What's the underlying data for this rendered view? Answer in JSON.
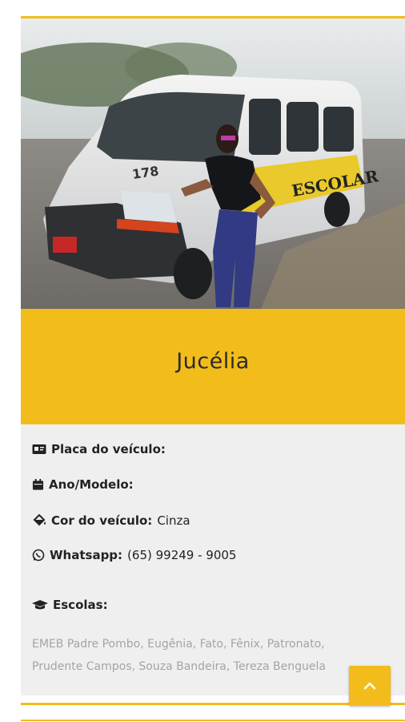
{
  "colors": {
    "accent": "#f2bc1b",
    "panel": "#efefef",
    "muted_text": "#a4a4a4"
  },
  "driver": {
    "name": "Jucélia"
  },
  "vehicle_photo": {
    "number": "178",
    "side_text": "ESCOLAR"
  },
  "details": {
    "plate": {
      "icon": "id-card-icon",
      "label": "Placa do veículo:",
      "value": ""
    },
    "year_model": {
      "icon": "calendar-icon",
      "label": "Ano/Modelo:",
      "value": ""
    },
    "color": {
      "icon": "paint-bucket-icon",
      "label": "Cor do veículo:",
      "value": "Cinza"
    },
    "whatsapp": {
      "icon": "whatsapp-icon",
      "label": "Whatsapp:",
      "value": "(65) 99249 - 9005"
    },
    "schools": {
      "icon": "graduation-cap-icon",
      "label": "Escolas:",
      "value": "EMEB Padre Pombo, Eugênia, Fato, Fênix, Patronato, Prudente Campos, Souza Bandeira, Tereza Benguela"
    }
  },
  "back_to_top": {
    "icon": "chevron-up-icon"
  }
}
